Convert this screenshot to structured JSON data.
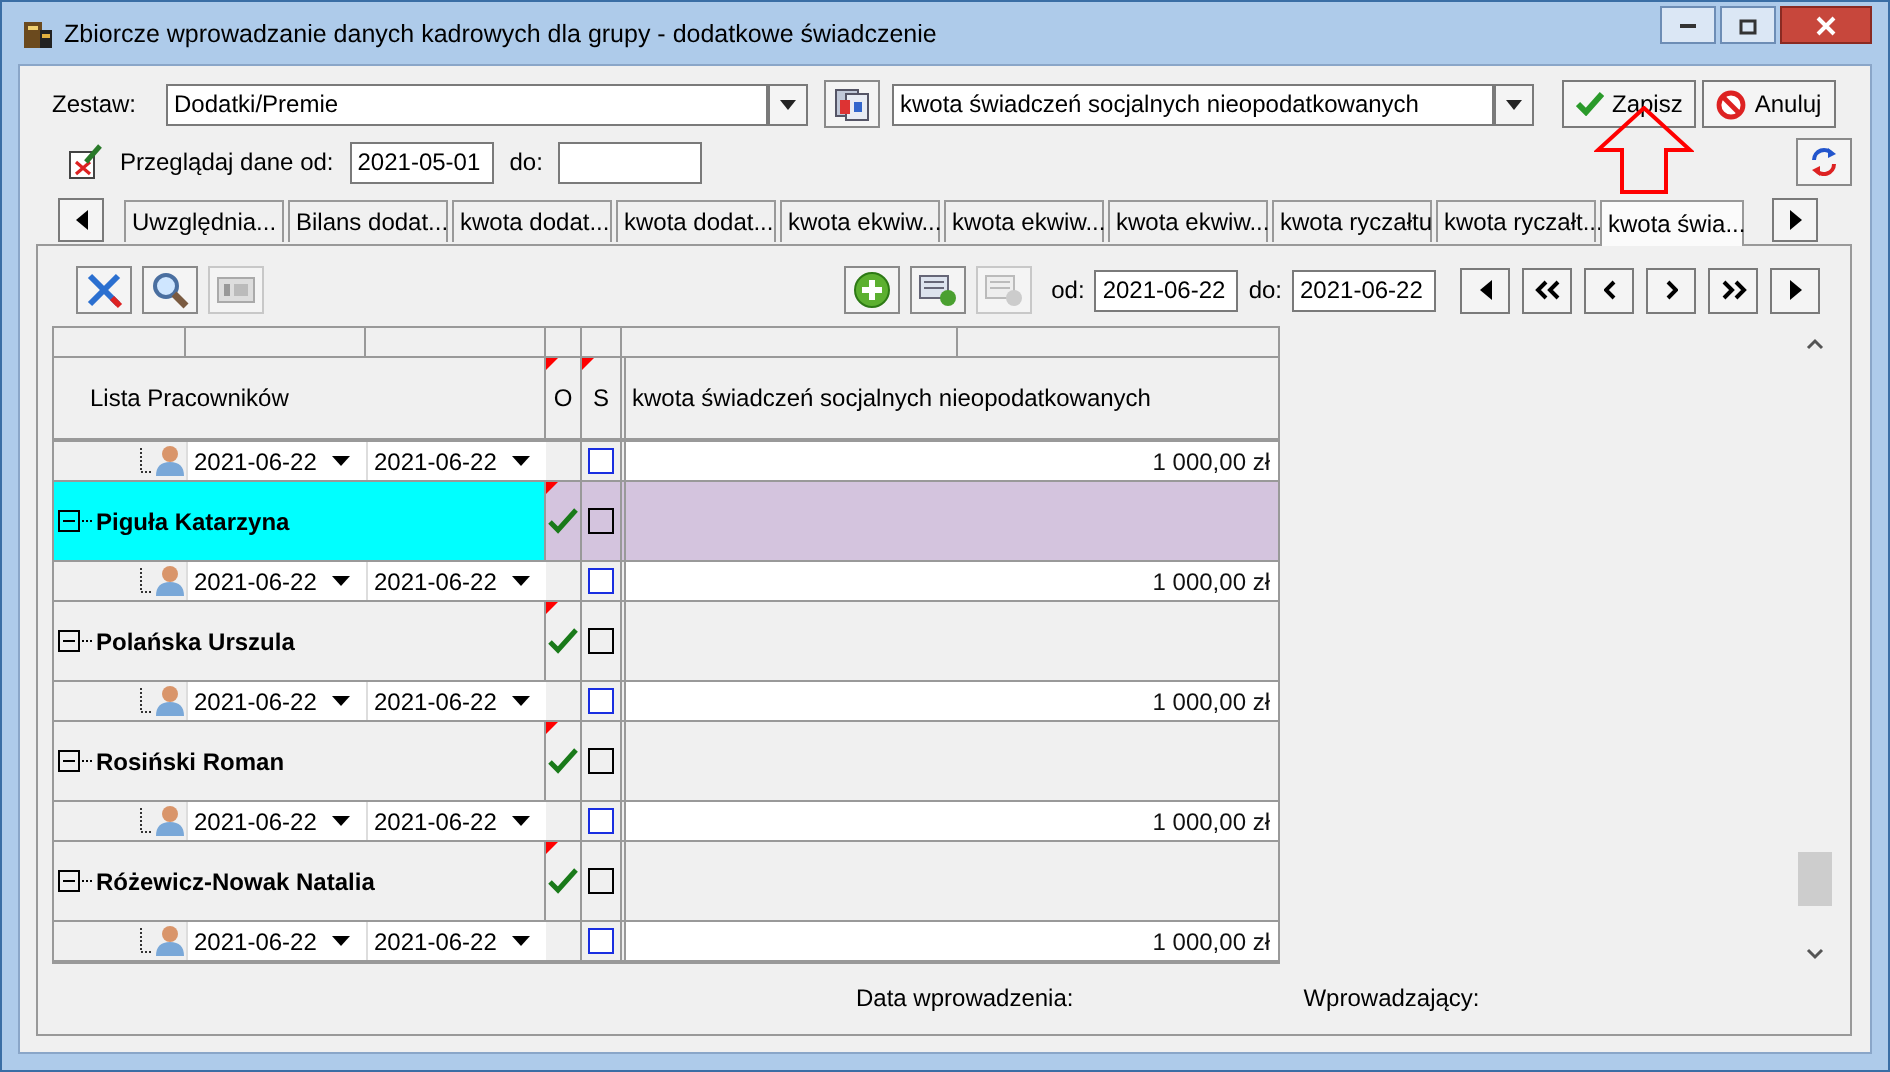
{
  "window": {
    "title": "Zbiorcze wprowadzanie danych kadrowych dla grupy  - dodatkowe świadczenie"
  },
  "set": {
    "label": "Zestaw:",
    "value": "Dodatki/Premie",
    "benefit": "kwota świadczeń socjalnych nieopodatkowanych"
  },
  "buttons": [
    {
      "kind": "save",
      "label": "Zapisz"
    },
    {
      "kind": "cancel",
      "label": "Anuluj"
    }
  ],
  "browse": {
    "label": "Przeglądaj dane od:",
    "from": "2021-05-01",
    "to_label": "do:"
  },
  "tabs": [
    {
      "label": "Uwzględnia...",
      "selected": false
    },
    {
      "label": "Bilans dodat...",
      "selected": false
    },
    {
      "label": "kwota dodat...",
      "selected": false
    },
    {
      "label": "kwota dodat...",
      "selected": false
    },
    {
      "label": "kwota ekwiw...",
      "selected": false
    },
    {
      "label": "kwota ekwiw...",
      "selected": false
    },
    {
      "label": "kwota ekwiw...",
      "selected": false
    },
    {
      "label": "kwota ryczałtu",
      "selected": false
    },
    {
      "label": "kwota ryczałt...",
      "selected": false
    },
    {
      "label": "kwota świa...",
      "selected": true
    }
  ],
  "toolbar": {
    "from_label": "od:",
    "from": "2021-06-22",
    "to_label": "do:",
    "to": "2021-06-22"
  },
  "grid": {
    "list_header": "Lista Pracowników",
    "o_header": "O",
    "s_header": "S",
    "amount_header": "kwota świadczeń socjalnych nieopodatkowanych",
    "rows": [
      {
        "kind": "period",
        "date_from": "2021-06-22",
        "date_to": "2021-06-22",
        "s_checked": false,
        "amount": "1 000,00 zł"
      },
      {
        "kind": "employee",
        "name": "Piguła Katarzyna",
        "selected": true,
        "expanded": true,
        "flagged": true,
        "o_checked": true,
        "s_checked": false
      },
      {
        "kind": "period",
        "date_from": "2021-06-22",
        "date_to": "2021-06-22",
        "s_checked": false,
        "amount": "1 000,00 zł"
      },
      {
        "kind": "employee",
        "name": "Polańska Urszula",
        "selected": false,
        "expanded": true,
        "flagged": true,
        "o_checked": true,
        "s_checked": false
      },
      {
        "kind": "period",
        "date_from": "2021-06-22",
        "date_to": "2021-06-22",
        "s_checked": false,
        "amount": "1 000,00 zł"
      },
      {
        "kind": "employee",
        "name": "Rosiński Roman",
        "selected": false,
        "expanded": true,
        "flagged": true,
        "o_checked": true,
        "s_checked": false
      },
      {
        "kind": "period",
        "date_from": "2021-06-22",
        "date_to": "2021-06-22",
        "s_checked": false,
        "amount": "1 000,00 zł"
      },
      {
        "kind": "employee",
        "name": "Różewicz-Nowak Natalia",
        "selected": false,
        "expanded": true,
        "flagged": true,
        "o_checked": true,
        "s_checked": false
      },
      {
        "kind": "period",
        "date_from": "2021-06-22",
        "date_to": "2021-06-22",
        "s_checked": false,
        "amount": "1 000,00 zł"
      }
    ]
  },
  "footer": {
    "entry_date_label": "Data wprowadzenia:",
    "entered_by_label": "Wprowadzający:"
  }
}
